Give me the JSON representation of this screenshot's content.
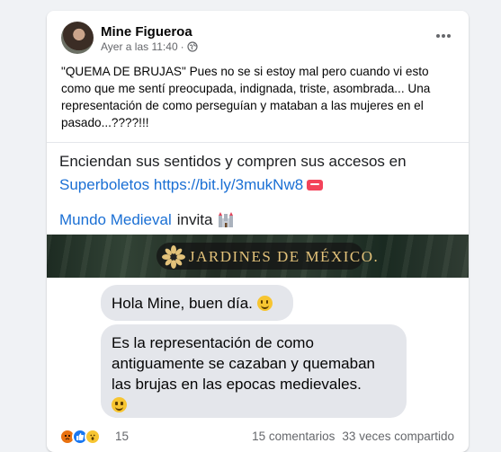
{
  "post": {
    "author": "Mine Figueroa",
    "timestamp": "Ayer a las 11:40",
    "separator": "·",
    "privacy_icon": "globe-icon",
    "more_icon": "more-options-icon",
    "caption": "\"QUEMA DE BRUJAS\" Pues no se si estoy mal pero cuando vi esto como que me sentí preocupada, indignada, triste, asombrada... Una representación de como perseguían y mataban a las mujeres en el pasado...????!!!"
  },
  "shared": {
    "promo_line1": "Enciendan sus sentidos y compren sus accesos en",
    "promo_link": "Superboletos https://bit.ly/3mukNw8",
    "ticket_icon": "ticket-icon",
    "page_name": "Mundo Medieval",
    "invite_text": "invita",
    "castle_icon": "castle-icon",
    "banner_brand": "JARDINES DE MÉXICO."
  },
  "chat": {
    "message1": "Hola Mine, buen día.",
    "message2": "Es la representación de como antiguamente se cazaban y quemaban las brujas en las epocas medievales."
  },
  "footer": {
    "reactions": [
      "angry-icon",
      "like-icon",
      "wow-icon"
    ],
    "reaction_count": "15",
    "comments": "15 comentarios",
    "shares": "33 veces compartido"
  },
  "colors": {
    "link": "#1a6fd4",
    "secondary_text": "#65676b",
    "bubble": "#e4e6eb",
    "card": "#ffffff",
    "background": "#f0f2f5"
  }
}
